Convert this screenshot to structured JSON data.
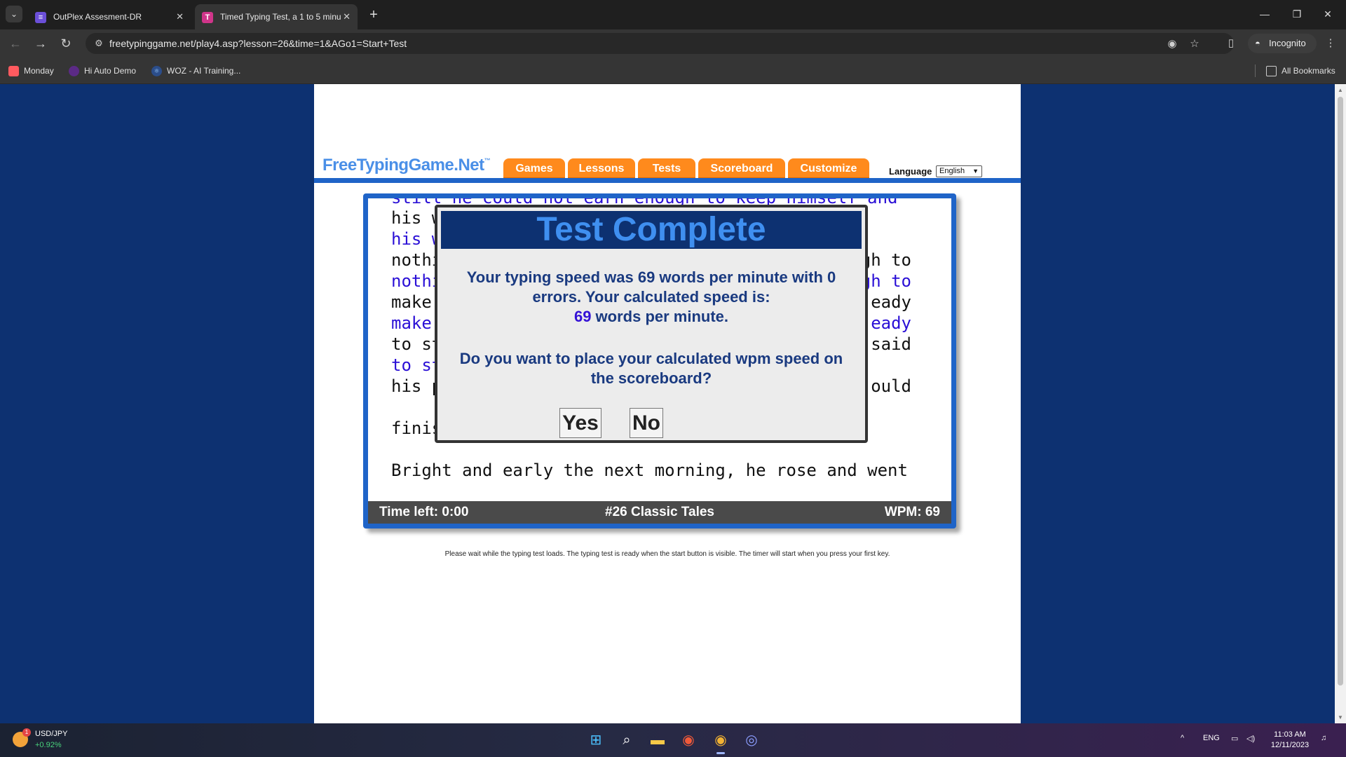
{
  "browser": {
    "tabs": [
      {
        "title": "OutPlex Assesment-DR",
        "active": false
      },
      {
        "title": "Timed Typing Test, a 1 to 5 minu",
        "active": true
      }
    ],
    "url": "freetypinggame.net/play4.asp?lesson=26&time=1&AGo1=Start+Test",
    "incognito_label": "Incognito",
    "bookmarks": [
      "Monday",
      "Hi Auto Demo",
      "WOZ - AI Training..."
    ],
    "all_bookmarks_label": "All Bookmarks"
  },
  "site": {
    "logo": "FreeTypingGame.Net",
    "logo_tm": "™",
    "nav": [
      "Games",
      "Lessons",
      "Tests",
      "Scoreboard",
      "Customize"
    ],
    "language_label": "Language",
    "language_value": "English"
  },
  "typing": {
    "top_line": "still he could not earn enough to keep himself and",
    "ref_lines": [
      {
        "left": "his w",
        "right": ""
      },
      {
        "left": "nothi",
        "right": "gh to"
      },
      {
        "left": "make",
        "right": "eady"
      },
      {
        "left": "to st",
        "right": "said"
      },
      {
        "left": "his p",
        "right": "ould"
      },
      {
        "left": "finis",
        "right": ""
      }
    ],
    "typed_lines": [
      {
        "left": "his w",
        "right": ""
      },
      {
        "left": "nothi",
        "right": "gh to"
      },
      {
        "left": "make",
        "right": "eady"
      },
      {
        "left": "to st",
        "right": ""
      }
    ],
    "next_line": "Bright and early the next morning, he rose and went",
    "status": {
      "time_left": "Time left: 0:00",
      "lesson": "#26 Classic Tales",
      "wpm": "WPM: 69"
    },
    "loading_note": "Please wait while the typing test loads. The typing test is ready when the start button is visible. The timer will start when you press your first key."
  },
  "modal": {
    "title": "Test Complete",
    "message_line1": "Your typing speed was 69 words per minute with 0",
    "message_line2": "errors. Your calculated speed is:",
    "calc_speed": "69",
    "calc_suffix": " words per minute.",
    "question_line1": "Do you want to place your calculated wpm speed on",
    "question_line2": "the scoreboard?",
    "yes_label": "Yes",
    "no_label": "No"
  },
  "taskbar": {
    "ticker_name": "USD/JPY",
    "ticker_change": "+0.92%",
    "ticker_badge": "1",
    "lang": "ENG",
    "time": "11:03 AM",
    "date": "12/11/2023"
  },
  "colors": {
    "page_background": "#0d3171",
    "nav_tab": "#ff8a1c",
    "accent_blue": "#1f64c8",
    "typed_text": "#2a0fd6",
    "modal_title": "#3f8ff0"
  }
}
